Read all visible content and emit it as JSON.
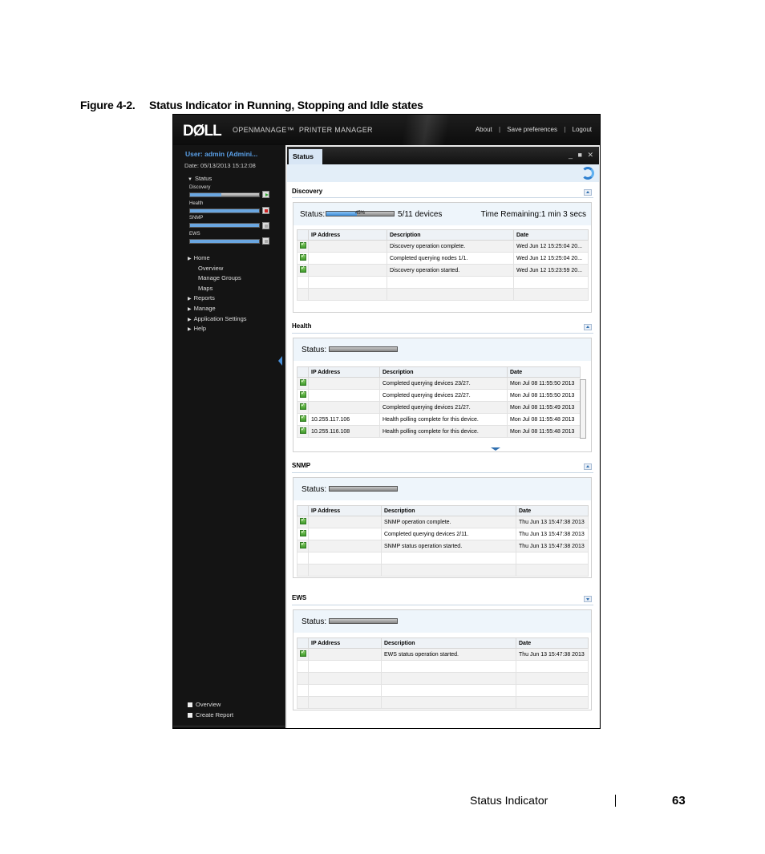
{
  "caption": {
    "number": "Figure 4-2.",
    "title": "Status Indicator in Running, Stopping and Idle states"
  },
  "header": {
    "logo": "DØLL",
    "product_name": "OPENMANAGE™",
    "product_sub": "PRINTER MANAGER",
    "links": {
      "about": "About",
      "save": "Save preferences",
      "logout": "Logout",
      "separator": "|"
    }
  },
  "sidebar": {
    "user": "User: admin (Admini...",
    "date": "Date: 05/13/2013 15:12:08",
    "status_label": "Status",
    "indicators": [
      {
        "label": "Discovery",
        "progress": 0.45,
        "state": "running"
      },
      {
        "label": "Health",
        "progress": 0,
        "state": "stopping"
      },
      {
        "label": "SNMP",
        "progress": 0,
        "state": "idle"
      },
      {
        "label": "EWS",
        "progress": 0,
        "state": "idle"
      }
    ],
    "nav": {
      "home": "Home",
      "overview": "Overview",
      "manage_groups": "Manage Groups",
      "maps": "Maps",
      "reports": "Reports",
      "manage": "Manage",
      "app_settings": "Application Settings",
      "help": "Help"
    },
    "footer": {
      "overview": "Overview",
      "create_report": "Create Report"
    }
  },
  "main": {
    "tab": "Status",
    "window_controls": "_ ■ ✕",
    "columns": {
      "ip": "IP Address",
      "desc": "Description",
      "date": "Date"
    },
    "discovery": {
      "title": "Discovery",
      "status_label": "Status:",
      "percent": "45%",
      "progress": 0.45,
      "devices": "5/11 devices",
      "remaining": "Time Remaining:1 min 3 secs",
      "rows": [
        {
          "ip": "",
          "desc": "Discovery operation complete.",
          "date": "Wed Jun 12 15:25:04 20..."
        },
        {
          "ip": "",
          "desc": "Completed querying nodes 1/1.",
          "date": "Wed Jun 12 15:25:04 20..."
        },
        {
          "ip": "",
          "desc": "Discovery operation started.",
          "date": "Wed Jun 12 15:23:59 20..."
        }
      ]
    },
    "health": {
      "title": "Health",
      "status_label": "Status:",
      "progress": 0,
      "rows": [
        {
          "ip": "",
          "desc": "Completed querying devices 23/27.",
          "date": "Mon Jul 08 11:55:50 2013"
        },
        {
          "ip": "",
          "desc": "Completed querying devices 22/27.",
          "date": "Mon Jul 08 11:55:50 2013"
        },
        {
          "ip": "",
          "desc": "Completed querying devices 21/27.",
          "date": "Mon Jul 08 11:55:49 2013"
        },
        {
          "ip": "10.255.117.106",
          "desc": "Health polling complete for this device.",
          "date": "Mon Jul 08 11:55:48 2013"
        },
        {
          "ip": "10.255.116.108",
          "desc": "Health polling complete for this device.",
          "date": "Mon Jul 08 11:55:48 2013"
        }
      ]
    },
    "snmp": {
      "title": "SNMP",
      "status_label": "Status:",
      "progress": 0,
      "rows": [
        {
          "ip": "",
          "desc": "SNMP operation complete.",
          "date": "Thu Jun 13 15:47:38 2013"
        },
        {
          "ip": "",
          "desc": "Completed querying devices 2/11.",
          "date": "Thu Jun 13 15:47:38 2013"
        },
        {
          "ip": "",
          "desc": "SNMP status operation started.",
          "date": "Thu Jun 13 15:47:38 2013"
        }
      ]
    },
    "ews": {
      "title": "EWS",
      "status_label": "Status:",
      "progress": 0,
      "rows": [
        {
          "ip": "",
          "desc": "EWS status operation started.",
          "date": "Thu Jun 13 15:47:38 2013"
        }
      ]
    }
  },
  "page_footer": {
    "section": "Status Indicator",
    "page": "63"
  }
}
